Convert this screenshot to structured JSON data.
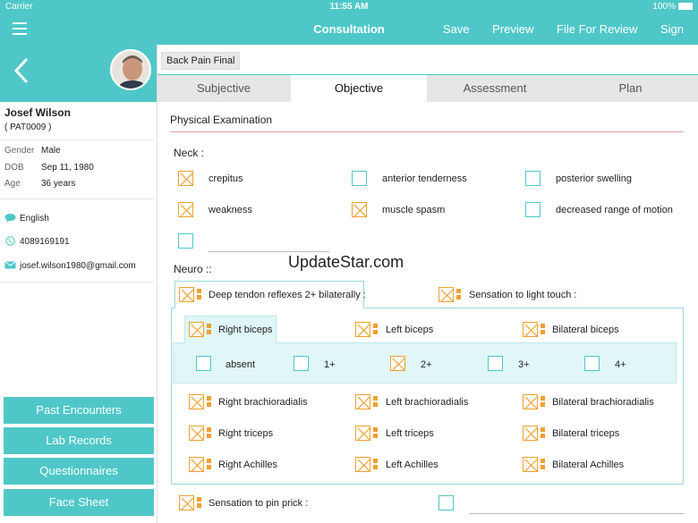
{
  "status_bar": {
    "carrier": "Carrier",
    "time": "11:55 AM",
    "battery": "100%"
  },
  "nav": {
    "title": "Consultation",
    "actions": [
      "Save",
      "Preview",
      "File For Review",
      "Sign"
    ]
  },
  "patient": {
    "name": "Josef Wilson",
    "id": "( PAT0009 )",
    "gender_label": "Gender",
    "gender": "Male",
    "dob_label": "DOB",
    "dob": "Sep 11, 1980",
    "age_label": "Age",
    "age": "36 years",
    "language": "English",
    "phone": "4089169191",
    "email": "josef.wilson1980@gmail.com"
  },
  "left_buttons": [
    "Past Encounters",
    "Lab Records",
    "Questionnaires",
    "Face Sheet"
  ],
  "case_name": "Back Pain Final",
  "tabs": [
    "Subjective",
    "Objective",
    "Assessment",
    "Plan"
  ],
  "active_tab": "Objective",
  "section_title": "Physical Examination",
  "neck": {
    "label": "Neck :",
    "items": [
      {
        "label": "crepitus",
        "checked": true
      },
      {
        "label": "anterior tenderness",
        "checked": false
      },
      {
        "label": "posterior swelling",
        "checked": false
      },
      {
        "label": "weakness",
        "checked": true
      },
      {
        "label": "muscle spasm",
        "checked": true
      },
      {
        "label": "decreased range of motion",
        "checked": false
      }
    ]
  },
  "neuro": {
    "label": "Neuro ::",
    "deep_tendon": "Deep tendon reflexes 2+ bilaterally :",
    "light_touch": "Sensation to light touch :",
    "biceps": [
      "Right biceps",
      "Left biceps",
      "Bilateral biceps"
    ],
    "grades": [
      {
        "label": "absent",
        "checked": false
      },
      {
        "label": "1+",
        "checked": false
      },
      {
        "label": "2+",
        "checked": true
      },
      {
        "label": "3+",
        "checked": false
      },
      {
        "label": "4+",
        "checked": false
      }
    ],
    "brachioradialis": [
      "Right brachioradialis",
      "Left brachioradialis",
      "Bilateral brachioradialis"
    ],
    "triceps": [
      "Right triceps",
      "Left triceps",
      "Bilateral triceps"
    ],
    "achilles": [
      "Right Achilles",
      "Left Achilles",
      "Bilateral Achilles"
    ],
    "pin_prick": "Sensation to pin prick :"
  },
  "watermark": "UpdateStar.com",
  "colors": {
    "teal": "#4fc7c8",
    "orange": "#f0a030"
  }
}
